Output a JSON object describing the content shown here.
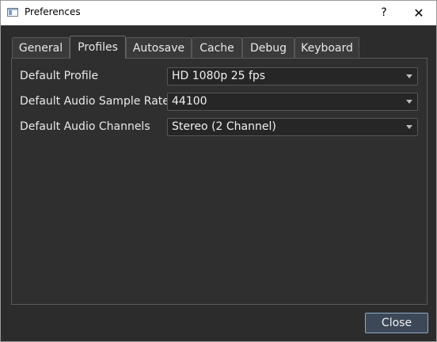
{
  "window": {
    "title": "Preferences",
    "help_label": "?",
    "close_label": "✕"
  },
  "tabs": [
    {
      "label": "General"
    },
    {
      "label": "Profiles"
    },
    {
      "label": "Autosave"
    },
    {
      "label": "Cache"
    },
    {
      "label": "Debug"
    },
    {
      "label": "Keyboard"
    }
  ],
  "active_tab": "Profiles",
  "settings": {
    "profile": {
      "label": "Default Profile",
      "value": "HD 1080p 25 fps"
    },
    "sample_rate": {
      "label": "Default Audio Sample Rate",
      "value": "44100"
    },
    "channels": {
      "label": "Default Audio Channels",
      "value": "Stereo (2 Channel)"
    }
  },
  "footer": {
    "close_button": "Close"
  },
  "colors": {
    "background": "#2c2c2c",
    "panel": "#2f2f2f",
    "accent_border": "#8fa9c8"
  }
}
